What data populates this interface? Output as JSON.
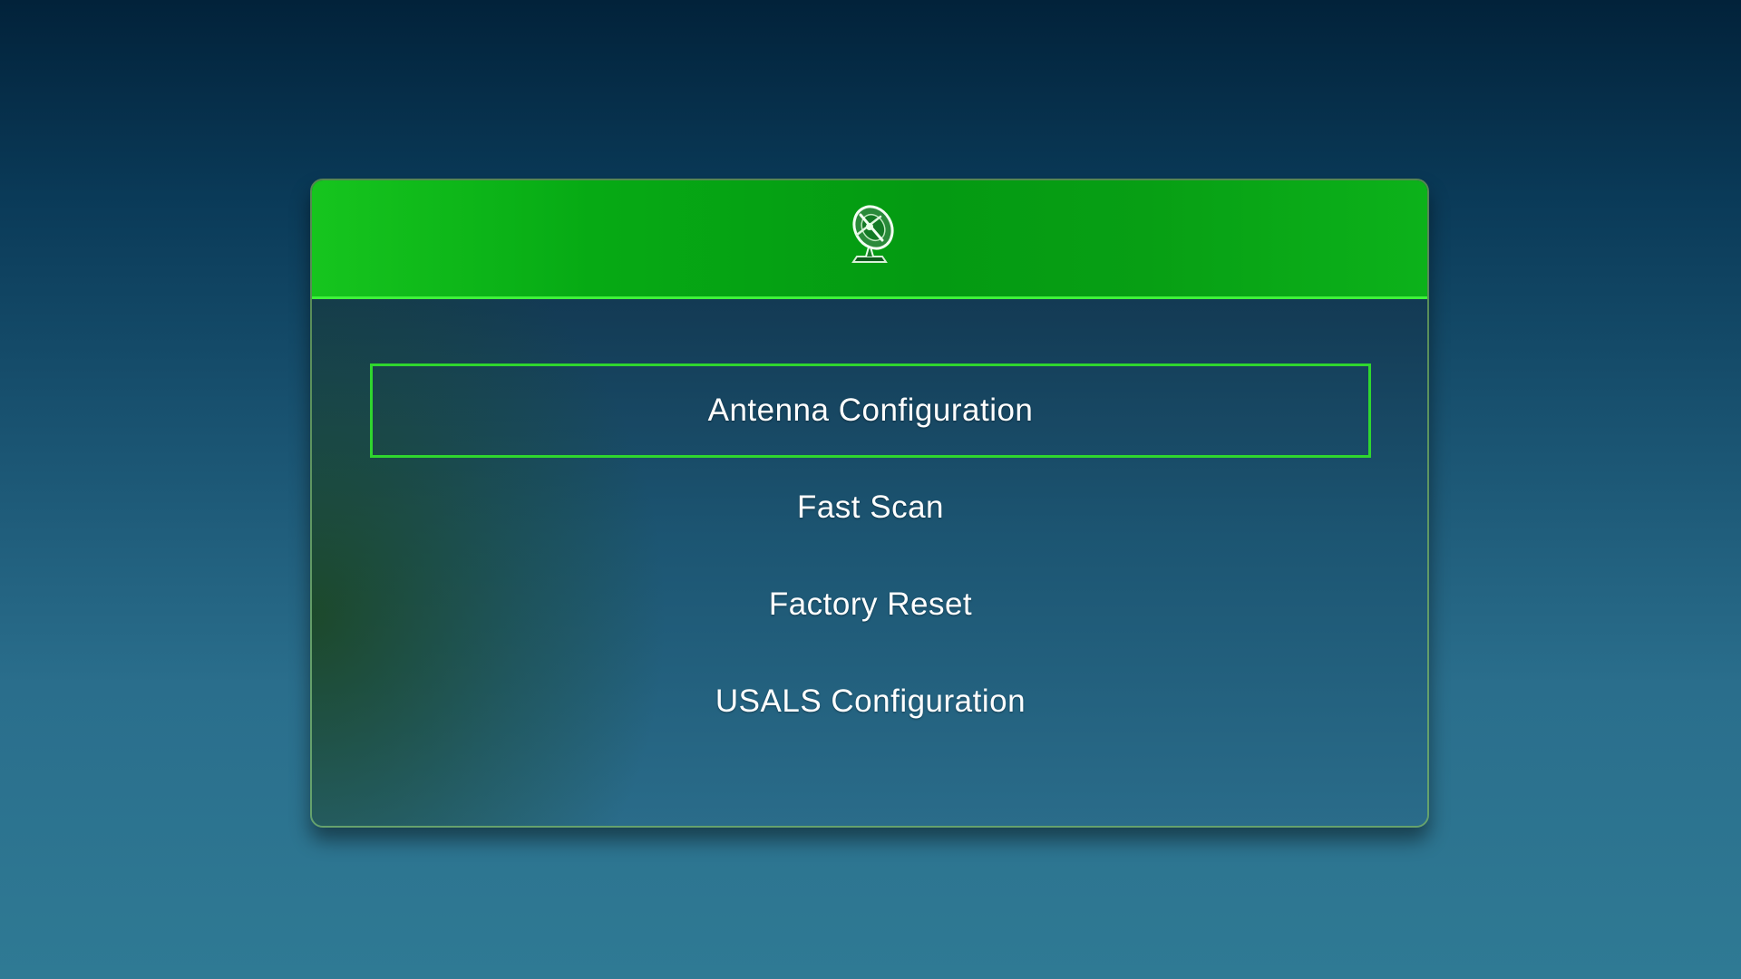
{
  "colors": {
    "header_green": "#06aa14",
    "selection_border": "#2fd62e",
    "text": "#ffffff"
  },
  "header": {
    "icon": "satellite-dish-icon"
  },
  "menu": {
    "selected_index": 0,
    "items": [
      {
        "label": "Antenna Configuration"
      },
      {
        "label": "Fast Scan"
      },
      {
        "label": "Factory Reset"
      },
      {
        "label": "USALS Configuration"
      }
    ]
  }
}
